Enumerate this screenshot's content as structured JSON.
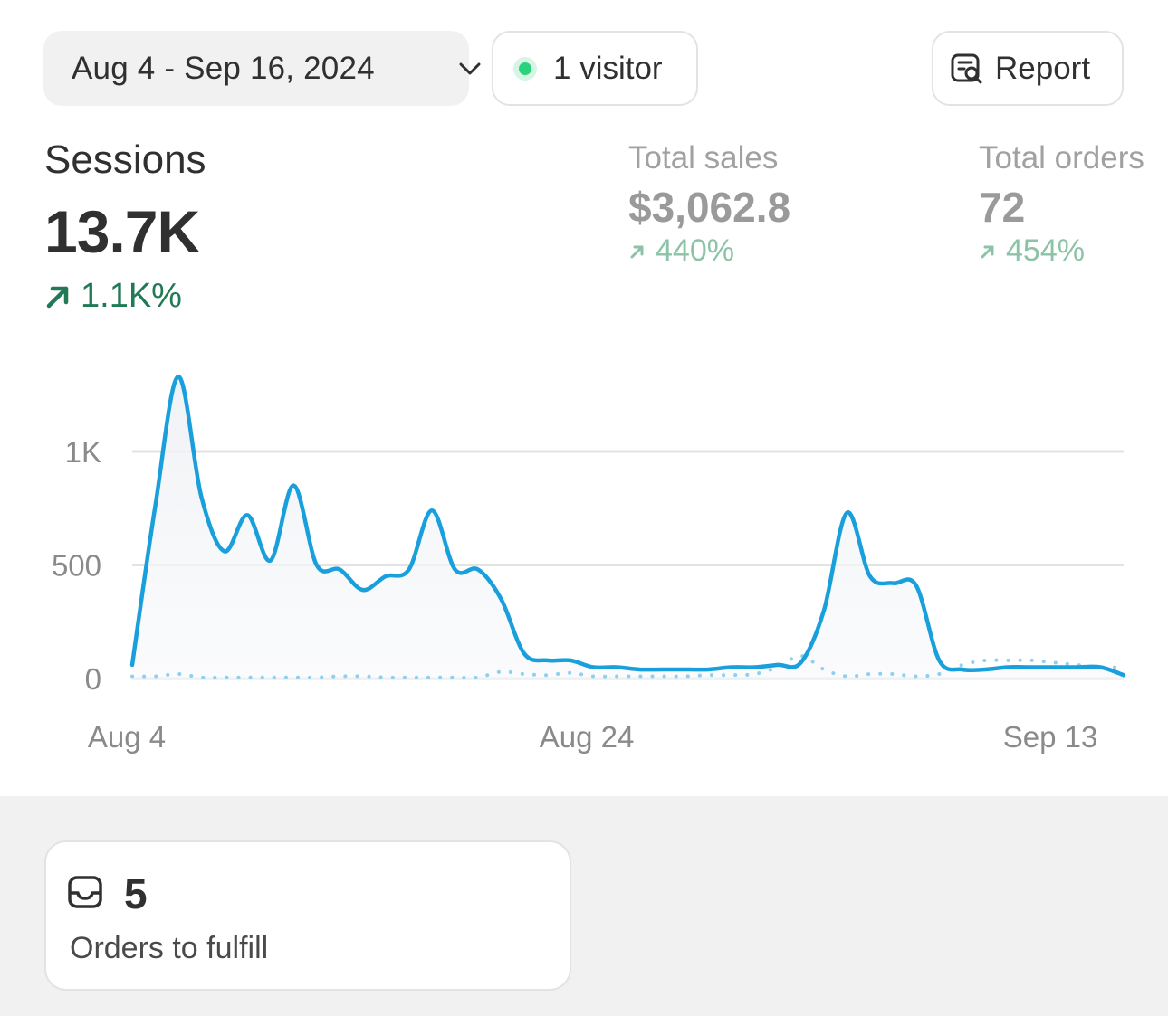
{
  "header": {
    "date_range": "Aug 4 - Sep 16, 2024",
    "live_visitors": "1 visitor",
    "report_label": "Report"
  },
  "metrics": {
    "sessions": {
      "title": "Sessions",
      "value": "13.7K",
      "change": "1.1K%"
    },
    "total_sales": {
      "title": "Total sales",
      "value": "$3,062.8",
      "change": "440%"
    },
    "total_orders": {
      "title": "Total orders",
      "value": "72",
      "change": "454%"
    }
  },
  "colors": {
    "primary_line": "#1a9fdd",
    "comparison_line": "#8fd0ef",
    "positive_change": "#207a55",
    "muted_positive_change": "#8cc3a7",
    "live_dot": "#29d37c"
  },
  "chart_data": {
    "type": "line",
    "x_ticks": [
      "Aug 4",
      "Aug 24",
      "Sep 13"
    ],
    "y_ticks": [
      "0",
      "500",
      "1K"
    ],
    "ylim": [
      0,
      1350
    ],
    "grid": true,
    "series": [
      {
        "values": [
          60,
          760,
          1330,
          800,
          560,
          720,
          520,
          850,
          500,
          480,
          390,
          450,
          480,
          740,
          480,
          480,
          350,
          110,
          80,
          80,
          50,
          50,
          40,
          40,
          40,
          40,
          50,
          50,
          60,
          70,
          300,
          730,
          450,
          420,
          410,
          80,
          40,
          40,
          50,
          50,
          50,
          50,
          50,
          15
        ]
      },
      {
        "values": [
          10,
          10,
          20,
          5,
          5,
          5,
          5,
          5,
          5,
          10,
          10,
          5,
          5,
          5,
          5,
          5,
          30,
          20,
          15,
          25,
          10,
          10,
          10,
          10,
          10,
          15,
          15,
          20,
          50,
          100,
          40,
          10,
          20,
          20,
          10,
          20,
          60,
          80,
          80,
          80,
          70,
          60,
          50,
          50
        ]
      }
    ]
  },
  "fulfillment": {
    "count": "5",
    "label": "Orders to fulfill"
  }
}
